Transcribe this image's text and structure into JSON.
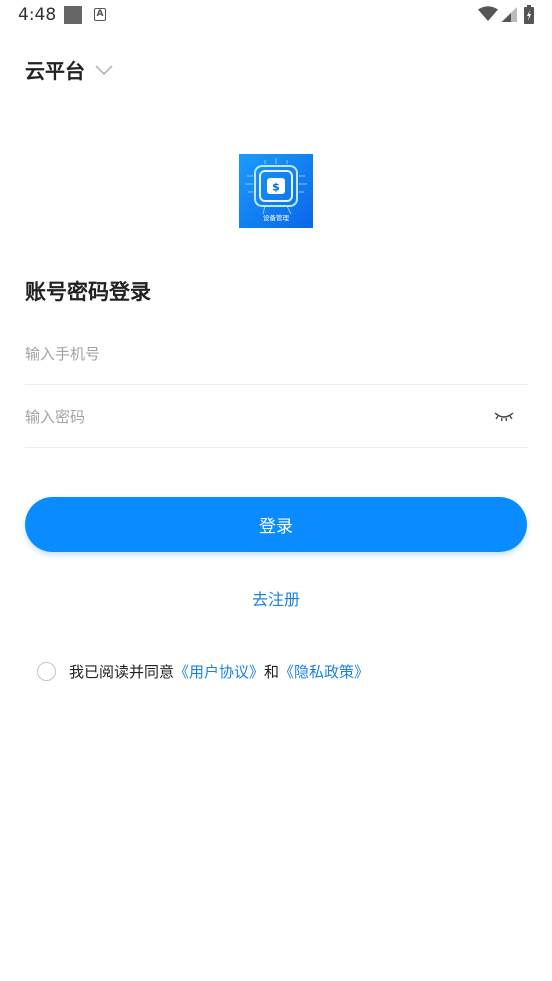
{
  "status_bar": {
    "time": "4:48",
    "a_badge": "A"
  },
  "header": {
    "platform_label": "云平台"
  },
  "logo": {
    "caption": "设备管理",
    "badge_glyph": "$"
  },
  "login": {
    "title": "账号密码登录",
    "phone_placeholder": "输入手机号",
    "password_placeholder": "输入密码",
    "phone_value": "",
    "password_value": "",
    "submit_label": "登录",
    "register_label": "去注册"
  },
  "agreement": {
    "prefix": "我已阅读并同意",
    "user_agreement": "《用户协议》",
    "connector": "和",
    "privacy_policy": "《隐私政策》",
    "checked": false
  },
  "colors": {
    "accent": "#0a8bff",
    "link": "#1a82e0",
    "divider": "#ececec",
    "placeholder": "#a3a3a3"
  }
}
